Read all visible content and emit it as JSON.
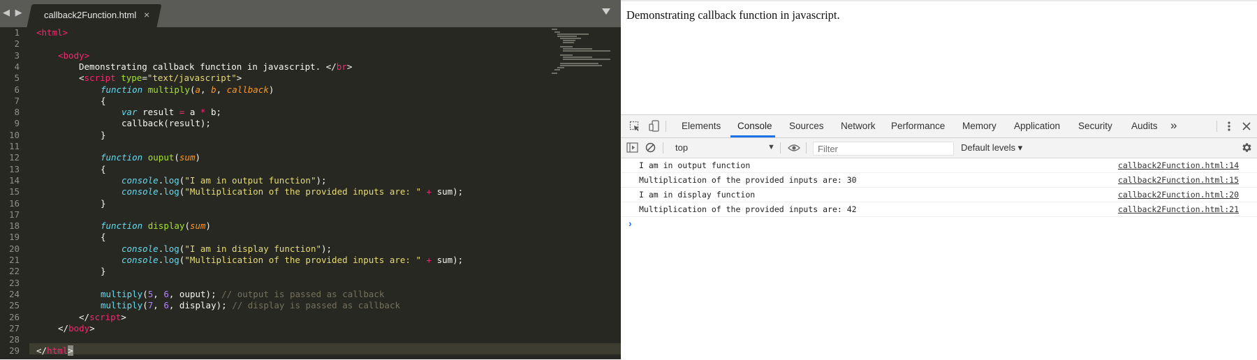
{
  "editor": {
    "tab_title": "callback2Function.html",
    "tab_close": "×",
    "nav_arrows": "◀ ▶",
    "line_numbers": [
      "1",
      "2",
      "3",
      "4",
      "5",
      "6",
      "7",
      "8",
      "9",
      "10",
      "11",
      "12",
      "13",
      "14",
      "15",
      "16",
      "17",
      "18",
      "19",
      "20",
      "21",
      "22",
      "23",
      "24",
      "25",
      "26",
      "27",
      "28",
      "29"
    ],
    "code": {
      "l1_open": "<",
      "l1_tag": "html",
      "l1_close": ">",
      "l3_open": "<",
      "l3_tag": "body",
      "l3_close": ">",
      "l4_text": "Demonstrating callback function in javascript. ",
      "l4_open": "</",
      "l4_tag": "br",
      "l4_close": ">",
      "l5_open": "<",
      "l5_tag": "script",
      "l5_attr": " type",
      "l5_eq": "=",
      "l5_str": "\"text/javascript\"",
      "l5_close": ">",
      "l6_kw": "function",
      "l6_fn": " multiply",
      "l6_p1": "(",
      "l6_a": "a",
      "l6_c1": ", ",
      "l6_b": "b",
      "l6_c2": ", ",
      "l6_cb": "callback",
      "l6_p2": ")",
      "l7": "{",
      "l8_kw": "var",
      "l8_txt": " result ",
      "l8_eq": "=",
      "l8_a": " a ",
      "l8_mul": "*",
      "l8_b": " b;",
      "l9": "callback(result);",
      "l10": "}",
      "l12_kw": "function",
      "l12_fn": " ouput",
      "l12_p1": "(",
      "l12_sum": "sum",
      "l12_p2": ")",
      "l13": "{",
      "l14_obj": "console",
      "l14_dot": ".",
      "l14_fn": "log",
      "l14_p1": "(",
      "l14_str": "\"I am in output function\"",
      "l14_p2": ");",
      "l15_obj": "console",
      "l15_dot": ".",
      "l15_fn": "log",
      "l15_p1": "(",
      "l15_str": "\"Multiplication of the provided inputs are: \"",
      "l15_plus": " + ",
      "l15_sum": "sum);",
      "l16": "}",
      "l18_kw": "function",
      "l18_fn": " display",
      "l18_p1": "(",
      "l18_sum": "sum",
      "l18_p2": ")",
      "l19": "{",
      "l20_obj": "console",
      "l20_dot": ".",
      "l20_fn": "log",
      "l20_p1": "(",
      "l20_str": "\"I am in display function\"",
      "l20_p2": ");",
      "l21_obj": "console",
      "l21_dot": ".",
      "l21_fn": "log",
      "l21_p1": "(",
      "l21_str": "\"Multiplication of the provided inputs are: \"",
      "l21_plus": " + ",
      "l21_sum": "sum);",
      "l22": "}",
      "l24_fn": "multiply",
      "l24_p1": "(",
      "l24_n1": "5",
      "l24_c1": ", ",
      "l24_n2": "6",
      "l24_rest": ", ouput); ",
      "l24_cm": "// output is passed as callback",
      "l25_fn": "multiply",
      "l25_p1": "(",
      "l25_n1": "7",
      "l25_c1": ", ",
      "l25_n2": "6",
      "l25_rest": ", display); ",
      "l25_cm": "// display is passed as callback",
      "l26_open": "</",
      "l26_tag": "script",
      "l26_close": ">",
      "l27_open": "</",
      "l27_tag": "body",
      "l27_close": ">",
      "l29_open": "</",
      "l29_tag": "html",
      "l29_close": ">"
    }
  },
  "page": {
    "text": "Demonstrating callback function in javascript."
  },
  "devtools": {
    "tabs": [
      "Elements",
      "Console",
      "Sources",
      "Network",
      "Performance",
      "Memory",
      "Application",
      "Security",
      "Audits"
    ],
    "more_tabs": "»",
    "active_tab": "Console",
    "context": "top",
    "filter_placeholder": "Filter",
    "levels": "Default levels ▾",
    "console_rows": [
      {
        "message": "I am in output function",
        "source": "callback2Function.html:14"
      },
      {
        "message": "Multiplication of the provided inputs are: 30",
        "source": "callback2Function.html:15"
      },
      {
        "message": "I am in display function",
        "source": "callback2Function.html:20"
      },
      {
        "message": "Multiplication of the provided inputs are: 42",
        "source": "callback2Function.html:21"
      }
    ],
    "prompt": "›"
  },
  "colors": {
    "editor_bg": "#272822",
    "tag": "#f92672",
    "string": "#e6db74",
    "keyword": "#66d9ef",
    "function": "#a6e22e",
    "param": "#fd971f",
    "number": "#ae81ff",
    "comment": "#75715e",
    "accent": "#1a73e8"
  }
}
